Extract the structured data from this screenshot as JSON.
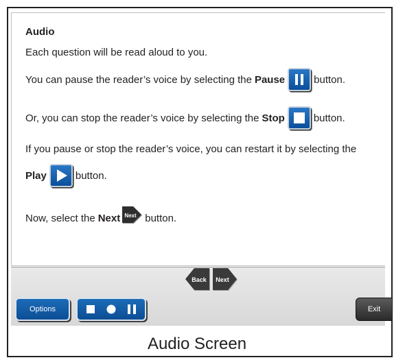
{
  "content": {
    "heading": "Audio",
    "line1": "Each question will be read aloud to you.",
    "line2": {
      "pre": "You can pause the reader’s voice by selecting the",
      "bold": "Pause",
      "post": "button."
    },
    "line3": {
      "pre": "Or, you can stop the reader’s voice by selecting the",
      "bold": "Stop",
      "post": "button."
    },
    "line4": "If you pause or stop the reader’s voice, you can restart it by selecting the",
    "line5": {
      "bold": "Play",
      "post": "button."
    },
    "line6": {
      "pre": "Now, select the",
      "bold": "Next",
      "post": "button.",
      "icon_label": "Next"
    }
  },
  "toolbar": {
    "back_label": "Back",
    "next_label": "Next",
    "options_label": "Options",
    "exit_label": "Exit",
    "player_icons": [
      "stop-icon",
      "record-icon",
      "pause-icon"
    ]
  },
  "caption": "Audio Screen",
  "colors": {
    "button_blue": "#0c4e95",
    "nav_dark": "#3a3a3a",
    "exit_dark": "#2a2a2a"
  }
}
